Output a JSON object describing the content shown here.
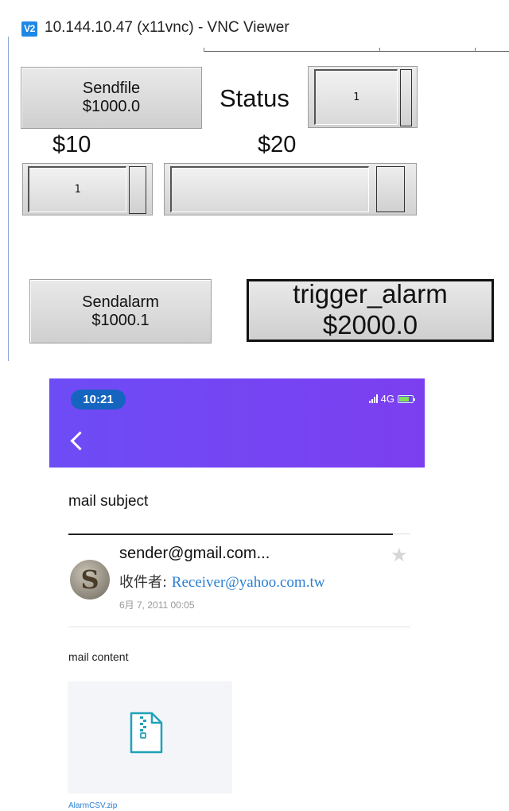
{
  "vnc": {
    "logo": "V2",
    "title": "10.144.10.47 (x11vnc) - VNC Viewer",
    "sendfile_button": {
      "line1": "Sendfile",
      "line2": "$1000.0"
    },
    "status_label": "Status",
    "status_value": "1",
    "label_10": "$10",
    "label_20": "$20",
    "spin_10_value": "1",
    "spin_20_value": "",
    "sendalarm_button": {
      "line1": "Sendalarm",
      "line2": "$1000.1"
    },
    "trigger_button": {
      "line1": "trigger_alarm",
      "line2": "$2000.0"
    }
  },
  "phone": {
    "time": "10:21",
    "network": "4G",
    "colors": {
      "header_start": "#6d4cf5",
      "header_end": "#7c3ff0",
      "link": "#2a7fd4"
    },
    "mail": {
      "subject": "mail subject",
      "sender": "sender@gmail.com...",
      "avatar_letter": "S",
      "receiver_label": "收件者: ",
      "receiver": "Receiver@yahoo.com.tw",
      "date": "6月 7, 2011 00:05",
      "content": "mail content",
      "attachment_name": "AlarmCSV.zip"
    }
  }
}
